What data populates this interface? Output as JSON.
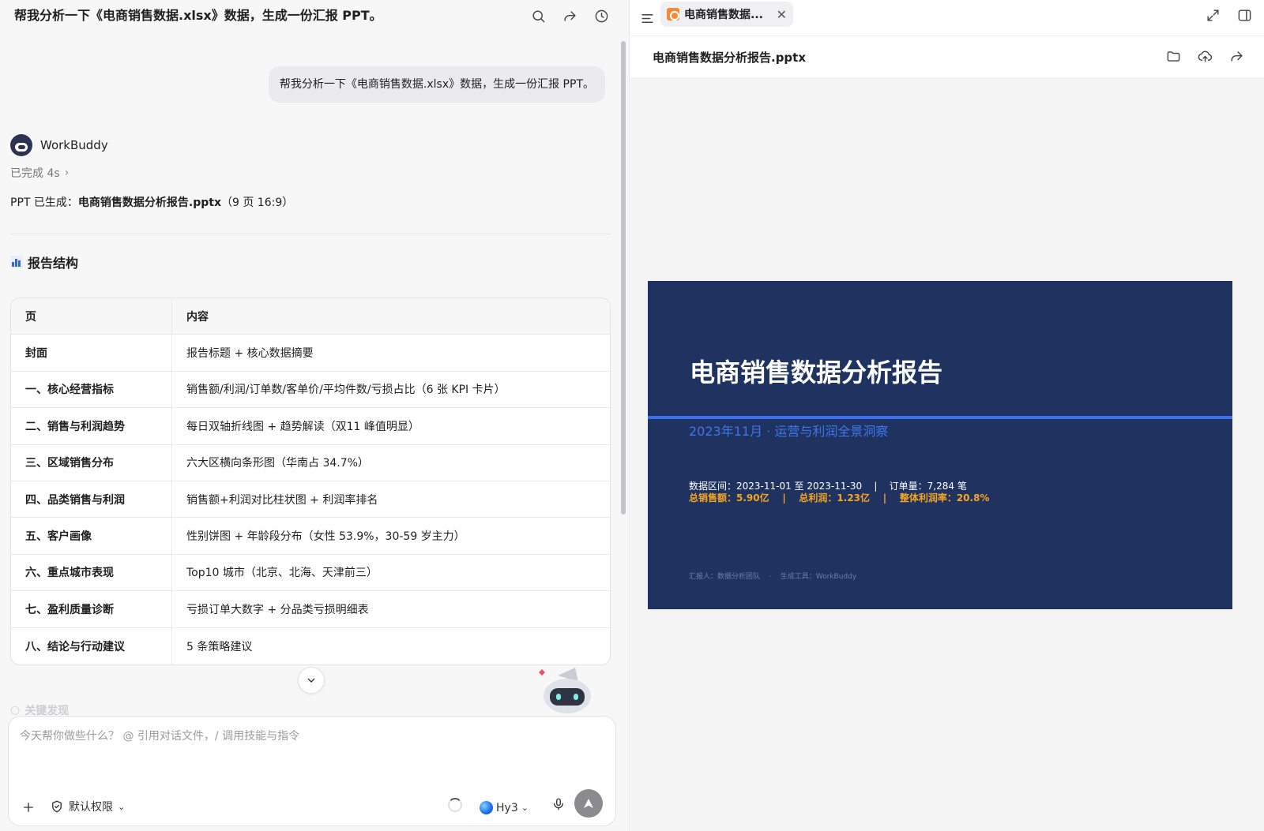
{
  "header": {
    "title": "帮我分析一下《电商销售数据.xlsx》数据，生成一份汇报 PPT。"
  },
  "conversation": {
    "user_message": "帮我分析一下《电商销售数据.xlsx》数据，生成一份汇报 PPT。",
    "bot_name": "WorkBuddy",
    "status": "已完成 4s",
    "generated_prefix": "PPT 已生成：",
    "generated_file": "电商销售数据分析报告.pptx",
    "generated_suffix": "（9 页 16:9）",
    "section_title": "报告结构",
    "table": {
      "headers": [
        "页",
        "内容"
      ],
      "rows": [
        [
          "封面",
          "报告标题 + 核心数据摘要"
        ],
        [
          "一、核心经营指标",
          "销售额/利润/订单数/客单价/平均件数/亏损占比（6 张 KPI 卡片）"
        ],
        [
          "二、销售与利润趋势",
          "每日双轴折线图 + 趋势解读（双11 峰值明显）"
        ],
        [
          "三、区域销售分布",
          "六大区横向条形图（华南占 34.7%）"
        ],
        [
          "四、品类销售与利润",
          "销售额+利润对比柱状图 + 利润率排名"
        ],
        [
          "五、客户画像",
          "性别饼图 + 年龄段分布（女性 53.9%，30-59 岁主力）"
        ],
        [
          "六、重点城市表现",
          "Top10 城市（北京、北海、天津前三）"
        ],
        [
          "七、盈利质量诊断",
          "亏损订单大数字 + 分品类亏损明细表"
        ],
        [
          "八、结论与行动建议",
          "5 条策略建议"
        ]
      ]
    },
    "faded_next_section": "关键发现"
  },
  "composer": {
    "placeholder": "今天帮你做些什么？ @ 引用对话文件，/ 调用技能与指令",
    "permission": "默认权限",
    "model": "Hy3"
  },
  "preview": {
    "tab_title": "电商销售数据...",
    "file_name": "电商销售数据分析报告.pptx",
    "slide": {
      "title": "电商销售数据分析报告",
      "subtitle": "2023年11月 · 运营与利润全景洞察",
      "info": "数据区间：2023-11-01 至 2023-11-30    |    订单量：7,284 笔",
      "kpi": "总销售额：5.90亿    |    总利润：1.23亿    |    整体利润率：20.8%",
      "footer": "汇报人：数据分析团队    ·    生成工具：WorkBuddy"
    }
  },
  "colors": {
    "slide_bg": "#203360",
    "accent_line": "#3a6ff0",
    "kpi": "#f5a524",
    "subtitle": "#3f74ea"
  }
}
